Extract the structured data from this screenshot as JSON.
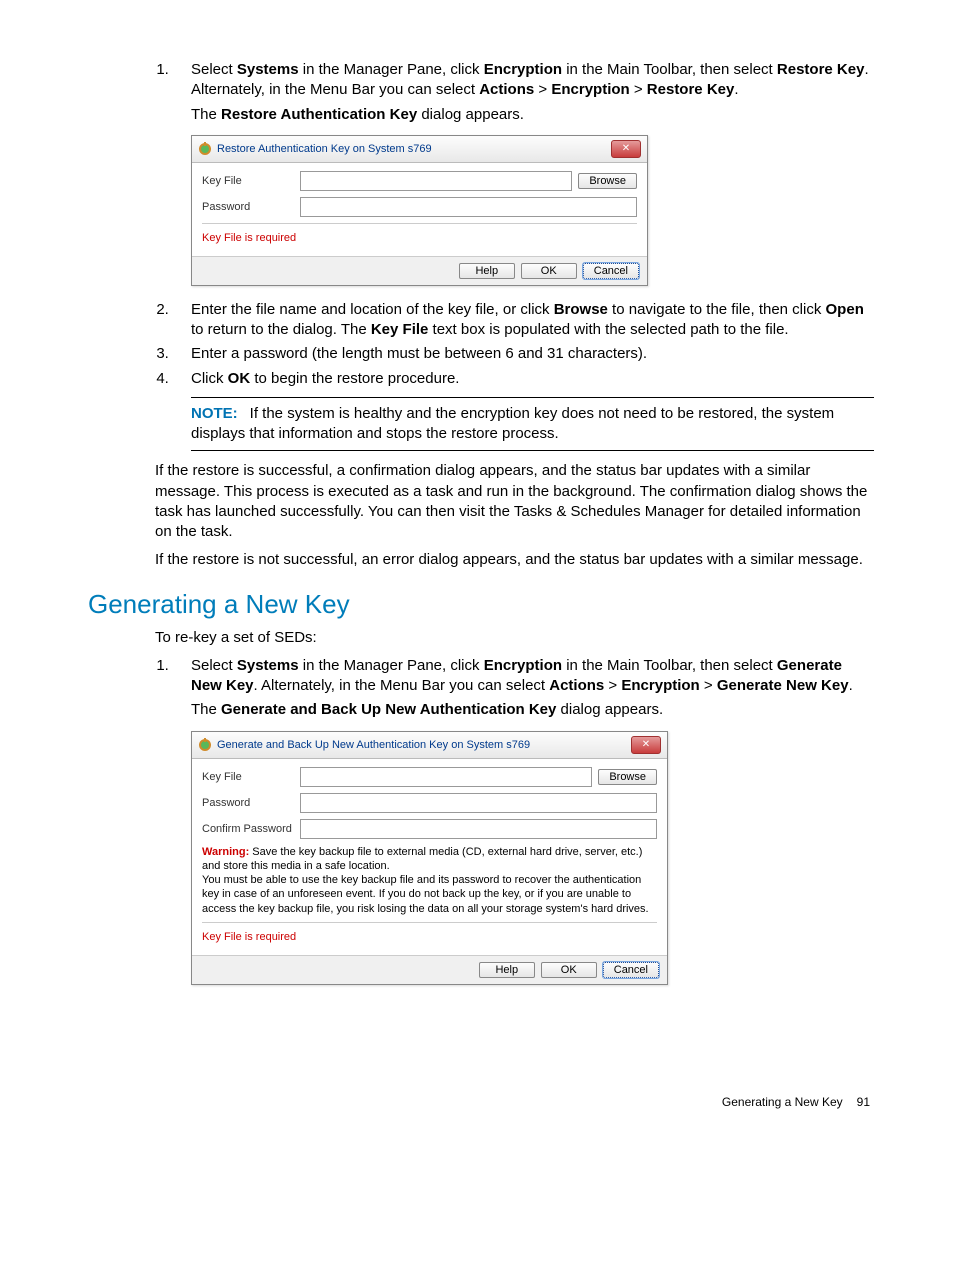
{
  "step1": {
    "prefix": "Select ",
    "b1": "Systems",
    "mid1": " in the Manager Pane, click ",
    "b2": "Encryption",
    "mid2": " in the Main Toolbar, then select ",
    "b3": "Restore Key",
    "mid3": ". Alternately, in the Menu Bar you can select ",
    "b4": "Actions",
    "gt1": " > ",
    "b5": "Encryption",
    "gt2": " > ",
    "b6": "Restore Key",
    "end": ".",
    "line2a": "The ",
    "line2b": "Restore Authentication Key",
    "line2c": " dialog appears."
  },
  "dialog1": {
    "title": "Restore Authentication Key on System s769",
    "key_file_label": "Key File",
    "password_label": "Password",
    "browse": "Browse",
    "validation": "Key File is required",
    "help": "Help",
    "ok": "OK",
    "cancel": "Cancel"
  },
  "step2": {
    "p1": "Enter the file name and location of the key file, or click ",
    "b1": "Browse",
    "p2": " to navigate to the file, then click ",
    "b2": "Open",
    "p3": " to return to the dialog. The ",
    "b3": "Key File",
    "p4": " text box is populated with the selected path to the file."
  },
  "step3": "Enter a password (the length must be between 6 and 31 characters).",
  "step4": {
    "p1": "Click ",
    "b1": "OK",
    "p2": " to begin the restore procedure."
  },
  "note": {
    "label": "NOTE:",
    "text": "If the system is healthy and the encryption key does not need to be restored, the system displays that information and stops the restore process."
  },
  "para1": "If the restore is successful, a confirmation dialog appears, and the status bar updates with a similar message. This process is executed as a task and run in the background. The confirmation dialog shows the task has launched successfully. You can then visit the Tasks & Schedules Manager for detailed information on the task.",
  "para2": "If the restore is not successful, an error dialog appears, and the status bar updates with a similar message.",
  "section_title": "Generating a New Key",
  "section_intro": "To re-key a set of SEDs:",
  "gstep1": {
    "prefix": "Select ",
    "b1": "Systems",
    "mid1": " in the Manager Pane, click ",
    "b2": "Encryption",
    "mid2": " in the Main Toolbar, then select ",
    "b3": "Generate New Key",
    "mid3": ". Alternately, in the Menu Bar you can select ",
    "b4": "Actions",
    "gt1": " > ",
    "b5": "Encryption",
    "gt2": " > ",
    "b6": "Generate New Key",
    "end": ".",
    "line2a": "The ",
    "line2b": "Generate and Back Up New Authentication Key",
    "line2c": " dialog appears."
  },
  "dialog2": {
    "title": "Generate and Back Up New Authentication Key on System s769",
    "key_file_label": "Key File",
    "password_label": "Password",
    "confirm_label": "Confirm Password",
    "browse": "Browse",
    "warn_label": "Warning:",
    "warn_text1": " Save the key backup file to external media (CD, external hard drive, server, etc.) and store this media in a safe location.",
    "warn_text2": "You must be able to use the key backup file and its password to recover the authentication key in case of an unforeseen event. If you do not back up the key, or if you are unable to access the key backup file, you risk losing the data on all your storage system's hard drives.",
    "validation": "Key File is required",
    "help": "Help",
    "ok": "OK",
    "cancel": "Cancel"
  },
  "footer": {
    "text": "Generating a New Key",
    "page": "91"
  }
}
